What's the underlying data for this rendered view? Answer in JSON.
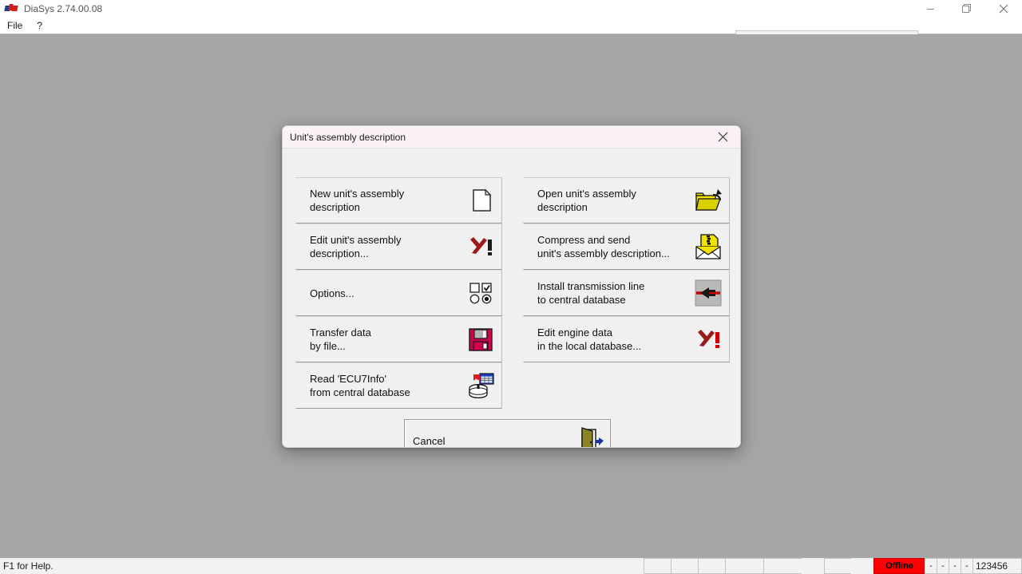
{
  "window": {
    "title": "DiaSys 2.74.00.08",
    "app_icon": "diasys-flag-icon",
    "controls": {
      "minimize": "minimize-icon",
      "restore": "restore-icon",
      "close": "close-icon"
    }
  },
  "menu": {
    "items": [
      {
        "label": "File"
      },
      {
        "label": "?"
      }
    ]
  },
  "dialog": {
    "title": "Unit's assembly description",
    "close_label": "✕",
    "left_column": [
      {
        "label": "New unit's assembly\ndescription",
        "icon": "new-document-icon"
      },
      {
        "label": "Edit unit's assembly\ndescription...",
        "icon": "edit-red-x-icon"
      },
      {
        "label": "Options...",
        "icon": "options-checkbox-radio-icon"
      },
      {
        "label": "Transfer data\nby file...",
        "icon": "floppy-disk-icon"
      },
      {
        "label": "Read 'ECU7Info'\nfrom central database",
        "icon": "database-read-icon"
      }
    ],
    "right_column": [
      {
        "label": "Open unit's assembly\ndescription",
        "icon": "open-folder-icon"
      },
      {
        "label": "Compress and send\nunit's assembly description...",
        "icon": "compress-send-envelope-icon"
      },
      {
        "label": "Install transmission line\nto central database",
        "icon": "transmission-line-icon"
      },
      {
        "label": "Edit engine data\nin the local database...",
        "icon": "edit-red-x-icon"
      }
    ],
    "cancel": {
      "label": "Cancel",
      "icon": "exit-door-icon"
    }
  },
  "status_bar": {
    "help_text": "F1 for Help.",
    "cells": [
      "",
      "",
      "",
      "",
      "",
      ""
    ],
    "connection": "Offline",
    "indicators": [
      "-",
      "-",
      "-",
      "-"
    ],
    "counter": "123456"
  },
  "colors": {
    "mdi_background": "#a6a6a6",
    "dialog_background": "#f0f0f0",
    "dialog_titlebar": "#fbf2f5",
    "offline_badge": "#ff0000",
    "accent_yellow": "#f2e200",
    "accent_red": "#9c1a1a"
  }
}
